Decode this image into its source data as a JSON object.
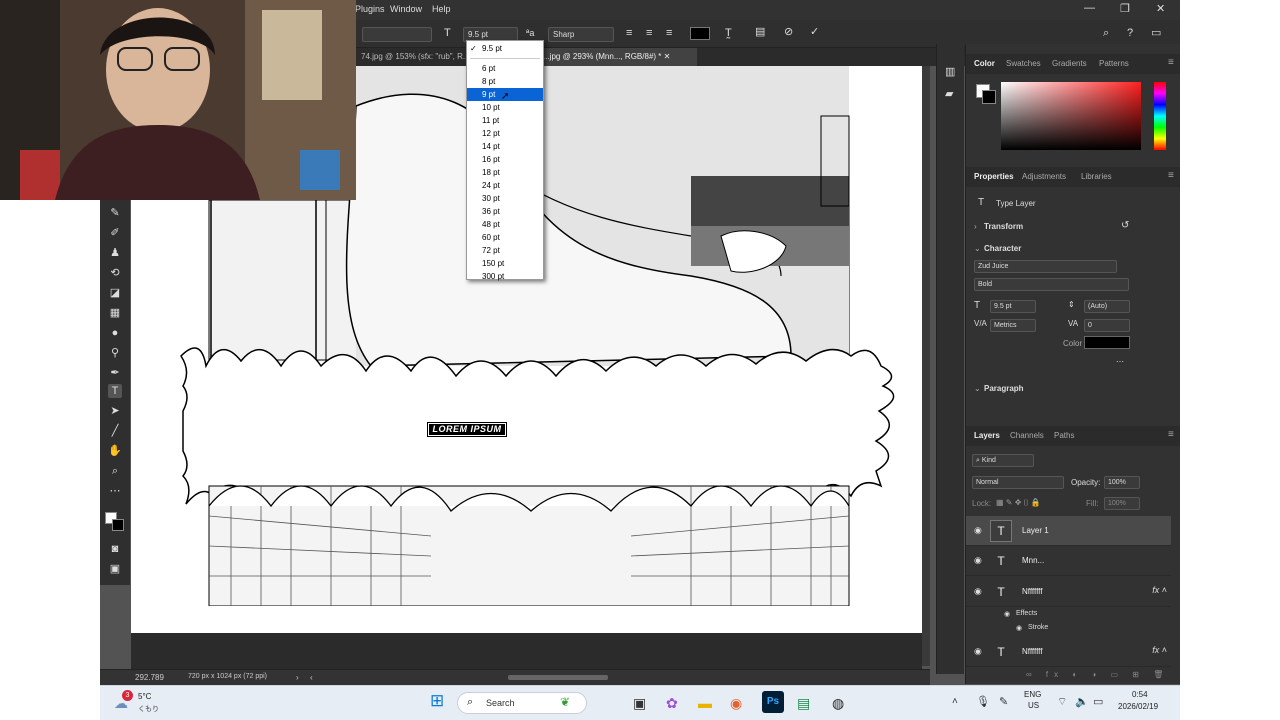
{
  "menubar": {
    "items": [
      "Plugins",
      "Window",
      "Help"
    ],
    "window_controls": [
      "—",
      "❐",
      "✕"
    ]
  },
  "options_bar": {
    "font_size": "9.5 pt",
    "aa_mode": "Sharp",
    "text_color": "#000000"
  },
  "tabs": [
    {
      "label": "74.jpg @ 153% (sfx: \"rub\", R...",
      "active": false
    },
    {
      "label": "...jpg @ 293% (Mnn..., RGB/8#) *",
      "active": true
    }
  ],
  "dropdown": {
    "current": "9.5 pt",
    "options": [
      "6 pt",
      "8 pt",
      "9 pt",
      "10 pt",
      "11 pt",
      "12 pt",
      "14 pt",
      "16 pt",
      "18 pt",
      "24 pt",
      "30 pt",
      "36 pt",
      "48 pt",
      "60 pt",
      "72 pt",
      "150 pt",
      "300 pt"
    ],
    "highlighted": "9 pt"
  },
  "canvas": {
    "text_label": "LOREM IPSUM"
  },
  "status": {
    "zoom": "292.789",
    "doc_size": "720 px x 1024 px (72 ppi)",
    "nav_next": "›",
    "nav_prev": "‹"
  },
  "color_panel": {
    "tabs": [
      "Color",
      "Swatches",
      "Gradients",
      "Patterns"
    ],
    "active": "Color"
  },
  "properties_panel": {
    "tabs": [
      "Properties",
      "Adjustments",
      "Libraries"
    ],
    "active": "Properties",
    "type_layer": "Type Layer",
    "transform": "Transform",
    "character": "Character",
    "font_family": "Zud Juice",
    "font_style": "Bold",
    "size": "9.5 pt",
    "leading": "(Auto)",
    "kerning": "Metrics",
    "tracking": "0",
    "color_label": "Color",
    "paragraph": "Paragraph"
  },
  "layers_panel": {
    "tabs": [
      "Layers",
      "Channels",
      "Paths"
    ],
    "active": "Layers",
    "kind": "Kind",
    "blend": "Normal",
    "opacity_label": "Opacity:",
    "opacity": "100%",
    "lock_label": "Lock:",
    "fill_label": "Fill:",
    "fill": "100%",
    "layers": [
      {
        "name": "Layer 1",
        "selected": true,
        "fx": false
      },
      {
        "name": "Mnn...",
        "selected": false,
        "fx": false
      },
      {
        "name": "Nfffffff",
        "selected": false,
        "fx": true
      },
      {
        "name": "Nfffffff",
        "selected": false,
        "fx": true
      }
    ],
    "effects_label": "Effects",
    "stroke_label": "Stroke"
  },
  "taskbar": {
    "weather_temp": "5°C",
    "weather_desc": "くもり",
    "search": "Search",
    "lang_top": "ENG",
    "lang_bottom": "US",
    "time": "0:54",
    "date": "2026/02/19",
    "badge": "3"
  }
}
